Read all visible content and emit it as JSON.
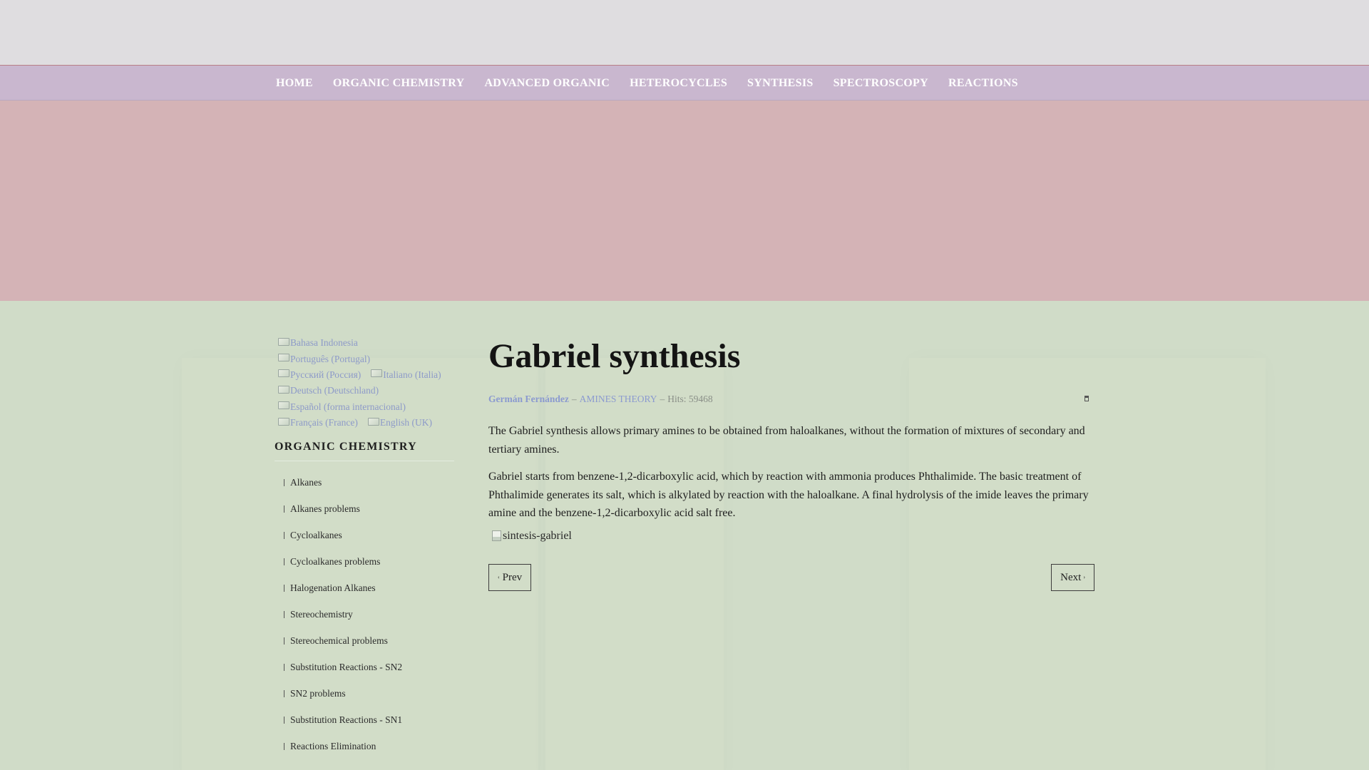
{
  "nav": {
    "items": [
      {
        "label": "HOME"
      },
      {
        "label": "ORGANIC CHEMISTRY"
      },
      {
        "label": "ADVANCED ORGANIC"
      },
      {
        "label": "HETEROCYCLES"
      },
      {
        "label": "SYNTHESIS"
      },
      {
        "label": "SPECTROSCOPY"
      },
      {
        "label": "REACTIONS"
      }
    ]
  },
  "languages": {
    "rows": [
      [
        {
          "label": "Bahasa Indonesia"
        }
      ],
      [
        {
          "label": "Português (Portugal)"
        }
      ],
      [
        {
          "label": "Русский (Россия)"
        },
        {
          "label": "Italiano (Italia)"
        }
      ],
      [
        {
          "label": "Deutsch (Deutschland)"
        }
      ],
      [
        {
          "label": "Español (forma internacional)"
        }
      ],
      [
        {
          "label": "Français (France)"
        },
        {
          "label": "English (UK)"
        }
      ]
    ]
  },
  "sidebar": {
    "title": "ORGANIC CHEMISTRY",
    "items": [
      {
        "label": "Alkanes"
      },
      {
        "label": "Alkanes problems"
      },
      {
        "label": "Cycloalkanes"
      },
      {
        "label": "Cycloalkanes problems"
      },
      {
        "label": "Halogenation Alkanes"
      },
      {
        "label": "Stereochemistry"
      },
      {
        "label": "Stereochemical problems"
      },
      {
        "label": "Substitution Reactions - SN2"
      },
      {
        "label": "SN2 problems"
      },
      {
        "label": "Substitution Reactions - SN1"
      },
      {
        "label": "Reactions Elimination"
      }
    ]
  },
  "article": {
    "title": "Gabriel synthesis",
    "author": "Germán Fernández",
    "dash1": "–",
    "category": "AMINES THEORY",
    "dash2": "–",
    "hits": "Hits: 59468",
    "paragraphs": [
      "The Gabriel synthesis allows primary amines to be obtained from haloalkanes, without the formation of mixtures of secondary and tertiary amines.",
      "Gabriel starts from benzene-1,2-dicarboxylic acid, which by reaction with ammonia produces Phthalimide. The basic treatment of Phthalimide generates its salt, which is alkylated by reaction with the haloalkane. A final hydrolysis of the imide leaves the primary amine and the benzene-1,2-dicarboxylic acid salt free."
    ],
    "image_alt": "sintesis-gabriel"
  },
  "pager": {
    "prev_label": "Prev",
    "next_label": "Next"
  },
  "colors": {
    "nav_bg": "#c9b7cf",
    "banner_bg": "#d4b3b6",
    "page_bg": "#d0dcc8",
    "link": "#8b9ad0"
  }
}
